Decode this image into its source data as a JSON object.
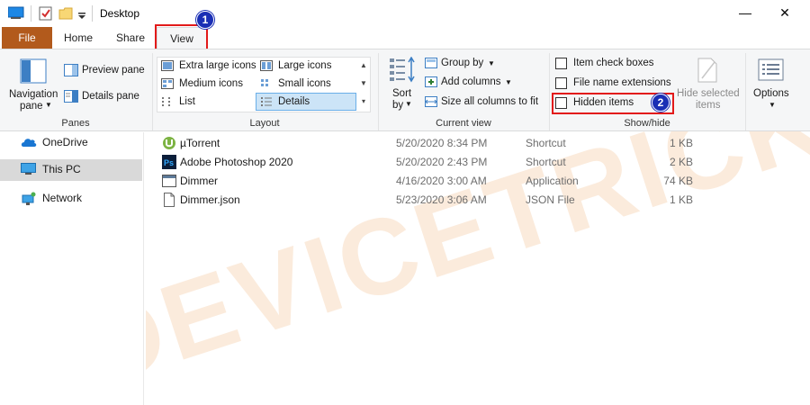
{
  "window": {
    "title": "Desktop",
    "minimize": "—",
    "close": "✕"
  },
  "tabs": [
    {
      "label": "File"
    },
    {
      "label": "Home"
    },
    {
      "label": "Share"
    },
    {
      "label": "View"
    }
  ],
  "annotations": {
    "step1": "1",
    "step2": "2",
    "highlight_color": "#e21a1a",
    "badge_color": "#1a2fb5"
  },
  "ribbon": {
    "panes": {
      "navigation_pane_line1": "Navigation",
      "navigation_pane_line2": "pane",
      "preview_pane": "Preview pane",
      "details_pane": "Details pane",
      "group_label": "Panes"
    },
    "layout": {
      "extra_large_icons": "Extra large icons",
      "large_icons": "Large icons",
      "medium_icons": "Medium icons",
      "small_icons": "Small icons",
      "list": "List",
      "details": "Details",
      "selected": "Details",
      "group_label": "Layout"
    },
    "current_view": {
      "sort_by_line1": "Sort",
      "sort_by_line2": "by",
      "group_by": "Group by",
      "add_columns": "Add columns",
      "size_all_columns": "Size all columns to fit",
      "group_label": "Current view"
    },
    "show_hide": {
      "item_check_boxes": "Item check boxes",
      "file_name_extensions": "File name extensions",
      "hidden_items": "Hidden items",
      "hide_selected_line1": "Hide selected",
      "hide_selected_line2": "items",
      "group_label": "Show/hide"
    },
    "options": {
      "label": "Options"
    }
  },
  "nav": {
    "items": [
      {
        "label": "OneDrive"
      },
      {
        "label": "This PC",
        "selected": true
      },
      {
        "label": "Network"
      }
    ]
  },
  "files": [
    {
      "name": "µTorrent",
      "date": "5/20/2020 8:34 PM",
      "type": "Shortcut",
      "size": "1 KB",
      "icon": "utorrent-icon"
    },
    {
      "name": "Adobe Photoshop 2020",
      "date": "5/20/2020 2:43 PM",
      "type": "Shortcut",
      "size": "2 KB",
      "icon": "photoshop-icon"
    },
    {
      "name": "Dimmer",
      "date": "4/16/2020 3:00 AM",
      "type": "Application",
      "size": "74 KB",
      "icon": "application-icon"
    },
    {
      "name": "Dimmer.json",
      "date": "5/23/2020 3:06 AM",
      "type": "JSON File",
      "size": "1 KB",
      "icon": "document-icon"
    }
  ],
  "watermark": {
    "text": "DEVICETRICKS",
    "color": "#f7e3cf"
  }
}
